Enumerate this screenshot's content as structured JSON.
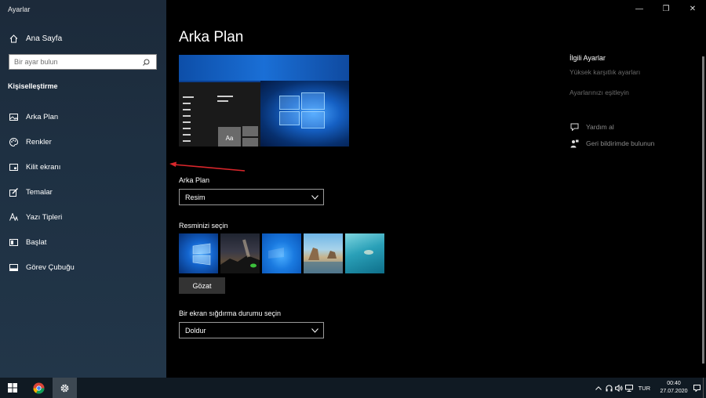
{
  "window": {
    "title": "Ayarlar",
    "minimize_glyph": "—",
    "maximize_glyph": "❐",
    "close_glyph": "✕"
  },
  "sidebar": {
    "home_label": "Ana Sayfa",
    "search_placeholder": "Bir ayar bulun",
    "section_title": "Kişiselleştirme",
    "items": [
      {
        "label": "Arka Plan",
        "icon": "picture-icon"
      },
      {
        "label": "Renkler",
        "icon": "palette-icon"
      },
      {
        "label": "Kilit ekranı",
        "icon": "lock-screen-icon"
      },
      {
        "label": "Temalar",
        "icon": "brush-icon"
      },
      {
        "label": "Yazı Tipleri",
        "icon": "font-icon"
      },
      {
        "label": "Başlat",
        "icon": "start-icon"
      },
      {
        "label": "Görev Çubuğu",
        "icon": "taskbar-icon"
      }
    ]
  },
  "main": {
    "title": "Arka Plan",
    "preview_tile_text": "Aa",
    "background_label": "Arka Plan",
    "background_value": "Resim",
    "choose_picture_label": "Resminizi seçin",
    "browse_label": "Gözat",
    "fit_label": "Bir ekran sığdırma durumu seçin",
    "fit_value": "Doldur"
  },
  "related": {
    "title": "İlgili Ayarlar",
    "links": [
      "Yüksek karşıtlık ayarları",
      "Ayarlarınızı eşitleyin"
    ],
    "help": [
      {
        "label": "Yardım al",
        "icon": "help-chat-icon"
      },
      {
        "label": "Geri bildirimde bulunun",
        "icon": "feedback-icon"
      }
    ]
  },
  "taskbar": {
    "language": "TUR",
    "time": "00:40",
    "date": "27.07.2020"
  },
  "colors": {
    "sidebar_bg": "#1e3042",
    "main_bg": "#000000",
    "taskbar_bg": "#101a23",
    "accent_red_arrow": "#d9262b"
  }
}
